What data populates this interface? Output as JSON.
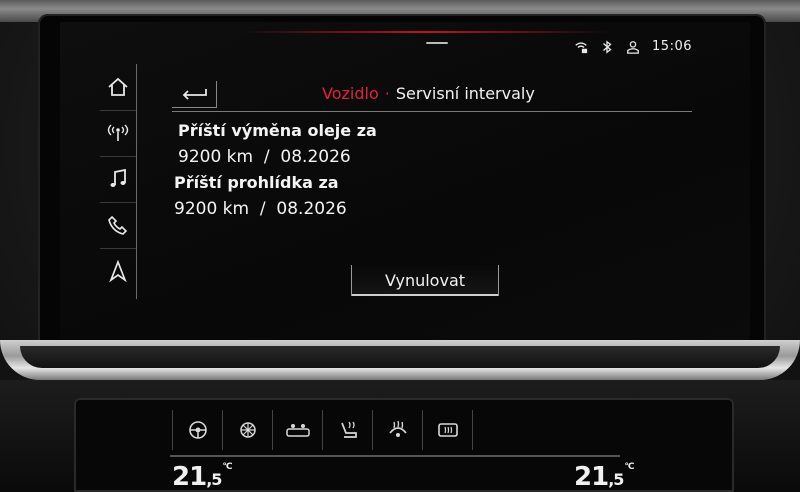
{
  "status_bar": {
    "time": "15:06",
    "icons": [
      "wifi-lock-icon",
      "bluetooth-icon",
      "user-profile-icon"
    ]
  },
  "nav": {
    "items": [
      {
        "id": "home",
        "icon": "home-icon"
      },
      {
        "id": "radio",
        "icon": "radio-antenna-icon"
      },
      {
        "id": "media",
        "icon": "music-note-icon"
      },
      {
        "id": "phone",
        "icon": "phone-icon"
      },
      {
        "id": "navigation",
        "icon": "navigation-arrow-icon"
      }
    ]
  },
  "header": {
    "breadcrumb_parent": "Vozidlo",
    "separator": "·",
    "title": "Servisní intervaly"
  },
  "oil_change": {
    "label": "Příští výměna oleje za",
    "value": "9200 km  /  08.2026"
  },
  "inspection": {
    "label": "Příští prohlídka za",
    "value": "9200 km  /  08.2026"
  },
  "reset_button": {
    "label": "Vynulovat"
  },
  "climate": {
    "left_temp": "21",
    "left_temp_decimal": ",5",
    "left_unit": "°C",
    "right_temp": "21",
    "right_temp_decimal": ",5",
    "right_unit": "°C",
    "icons": [
      "steering-wheel-heat-icon",
      "seat-ventilation-icon",
      "rear-seat-icon",
      "seat-heat-icon",
      "steering-heat-icon",
      "rear-window-defrost-icon"
    ]
  },
  "colors": {
    "accent": "#e0233a",
    "text": "#f4f4f4",
    "background": "#0a0a0a"
  }
}
